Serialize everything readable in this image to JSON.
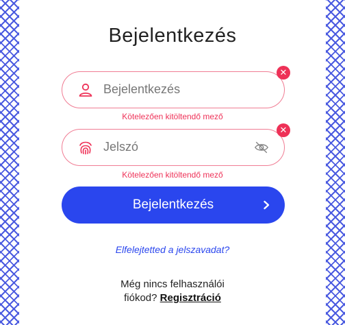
{
  "page": {
    "title": "Bejelentkezés"
  },
  "username": {
    "placeholder": "Bejelentkezés",
    "error": "Kötelezően kitöltendő mező",
    "icon": "user-icon"
  },
  "password": {
    "placeholder": "Jelszó",
    "error": "Kötelezően kitöltendő mező",
    "icon": "fingerprint-icon",
    "toggle_icon": "eye-slash-icon"
  },
  "clear_icon": "close-icon",
  "login": {
    "label": "Bejelentkezés",
    "icon": "chevron-right-icon"
  },
  "forgot": {
    "label": "Elfelejtetted a jelszavadat?"
  },
  "signup": {
    "line1": "Még nincs felhasználói",
    "line2": "fiókod?",
    "link": "Regisztráció"
  },
  "colors": {
    "accent": "#2a46ee",
    "error": "#ee3157",
    "border": "#4a5ae0"
  }
}
